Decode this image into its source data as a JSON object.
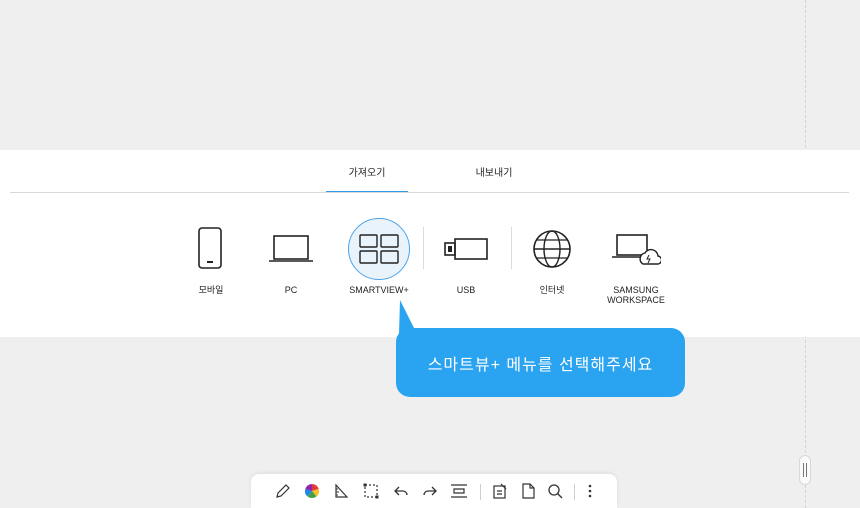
{
  "tabs": [
    {
      "label": "가져오기",
      "active": true
    },
    {
      "label": "내보내기",
      "active": false
    }
  ],
  "sources": [
    {
      "label": "모바일",
      "icon": "mobile-icon"
    },
    {
      "label": "PC",
      "icon": "laptop-icon"
    },
    {
      "label": "SMARTVIEW+",
      "icon": "smartview-grid-icon",
      "selected": true
    },
    {
      "label": "USB",
      "icon": "usb-icon"
    },
    {
      "label": "인터넷",
      "icon": "globe-icon"
    },
    {
      "label": "SAMSUNG\nWORKSPACE",
      "icon": "laptop-cloud-icon"
    }
  ],
  "tooltip": {
    "text": "스마트뷰+ 메뉴를 선택해주세요"
  },
  "toolbar": {
    "tools": [
      "pen-icon",
      "color-palette-icon",
      "ruler-icon",
      "select-icon",
      "undo-icon",
      "redo-icon",
      "fit-width-icon",
      "import-icon",
      "page-icon",
      "search-icon",
      "more-icon"
    ]
  },
  "colors": {
    "accent": "#2f9be6",
    "tooltip": "#2aa3f0",
    "palette": [
      "#e53935",
      "#fbc02d",
      "#43a047",
      "#1e88e5",
      "#8e24aa"
    ]
  }
}
